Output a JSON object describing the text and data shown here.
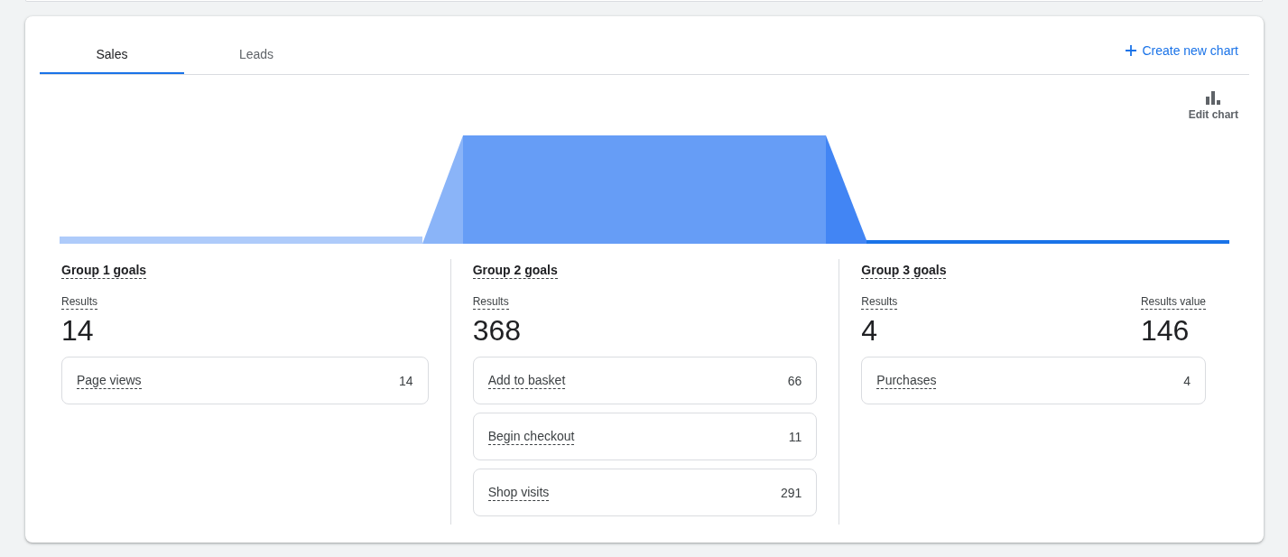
{
  "tabs": [
    {
      "label": "Sales",
      "selected": true
    },
    {
      "label": "Leads",
      "selected": false
    }
  ],
  "create_button": {
    "label": "Create new chart"
  },
  "edit_chart": {
    "label": "Edit chart"
  },
  "groups": [
    {
      "title": "Group 1 goals",
      "metrics": [
        {
          "label": "Results",
          "value": "14"
        }
      ],
      "goals": [
        {
          "name": "Page views",
          "value": "14"
        }
      ]
    },
    {
      "title": "Group 2 goals",
      "metrics": [
        {
          "label": "Results",
          "value": "368"
        }
      ],
      "goals": [
        {
          "name": "Add to basket",
          "value": "66"
        },
        {
          "name": "Begin checkout",
          "value": "11"
        },
        {
          "name": "Shop visits",
          "value": "291"
        }
      ]
    },
    {
      "title": "Group 3 goals",
      "metrics": [
        {
          "label": "Results",
          "value": "4"
        },
        {
          "label": "Results value",
          "value": "146"
        }
      ],
      "goals": [
        {
          "name": "Purchases",
          "value": "4"
        }
      ]
    }
  ]
}
